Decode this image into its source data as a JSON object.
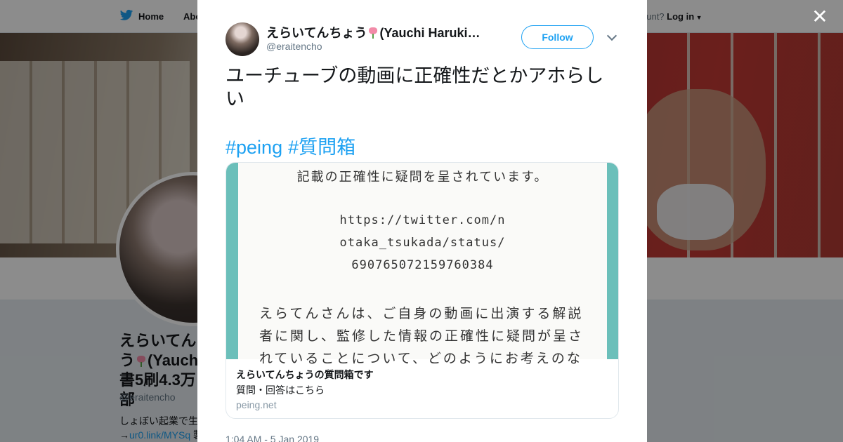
{
  "nav": {
    "home_label": "Home",
    "about_label": "Abo",
    "account_prompt": "ccount?",
    "login_label": "Log in"
  },
  "background_profile": {
    "name": "えらいてんちょう(Yauchi Haruki)著書5刷4.3万部",
    "name_visible_lines": [
      "えらいてん",
      "う",
      "(Yauch",
      "書5刷4.3万部"
    ],
    "handle": "@eraitencho",
    "bio_line1": "しょぼい起業で生",
    "bio_link": "ur0.link/MYSq",
    "bio_after_link": "製"
  },
  "modal": {
    "close_icon": "close-icon",
    "author": {
      "name_before": "えらいてんちょう",
      "name_after": "(Yauchi Haruki…",
      "handle": "@eraitencho"
    },
    "follow_label": "Follow",
    "tweet_text": "ユーチューブの動画に正確性だとかアホらしい",
    "hashtags": [
      "#peing",
      "#質問箱"
    ],
    "card": {
      "image_lines": [
        "記載の正確性に疑問を呈されています。",
        "https://twitter.com/n",
        "otaka_tsukada/status/",
        "690765072159760384",
        "えらてんさんは、ご自身の動画に出演する解説",
        "者に関し、監修した情報の正確性に疑問が呈さ",
        "れていることについて、どのようにお考えのな"
      ],
      "title": "えらいてんちょうの質問箱です",
      "description": "質問・回答はこちら",
      "domain": "peing.net"
    },
    "timestamp": "1:04 AM - 5 Jan 2019"
  },
  "colors": {
    "accent": "#1da1f2",
    "card_teal": "#6bbfba",
    "overlay": "rgba(0,0,0,0.45)"
  }
}
